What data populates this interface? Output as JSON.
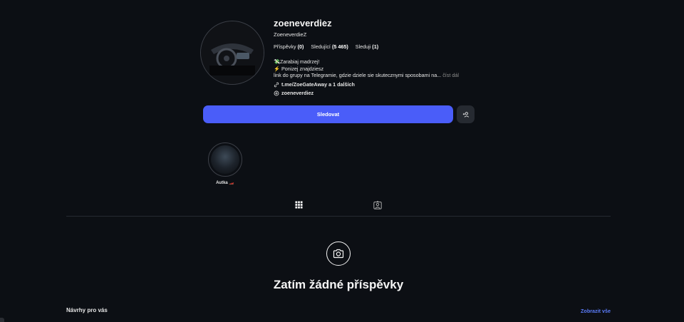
{
  "profile": {
    "username": "zoeneverdiez",
    "more_label": "···",
    "full_name": "ZoeneverdieZ",
    "stats": {
      "posts_label": "Příspěvky",
      "posts_count": "(0)",
      "followers_label": "Sledující",
      "followers_count": "(5 465)",
      "following_label": "Sleduji",
      "following_count": "(1)"
    },
    "bio": {
      "line1": "💸Zarabiaj madrzej!",
      "line2": "⚡ Ponizej znajdziesz",
      "line3": "link do grupy na Telegramie, gdzie dziele sie skutecznymi sposobami na...",
      "more": "číst dál"
    },
    "link": "t.me/ZoeGateAway a 1 dalších",
    "threads": "zoeneverdiez"
  },
  "actions": {
    "follow_label": "Sledovat",
    "suggest_icon": "person-add-icon"
  },
  "highlights": [
    {
      "label": "Autka 🏎️"
    }
  ],
  "tabs": [
    {
      "icon": "grid-icon",
      "active": true
    },
    {
      "icon": "tagged-icon",
      "active": false
    }
  ],
  "empty_state": {
    "icon": "camera-icon",
    "title": "Zatím žádné příspěvky"
  },
  "suggestions": {
    "title": "Návrhy pro vás",
    "see_all": "Zobrazit vše"
  },
  "colors": {
    "background": "#0c0f14",
    "accent": "#4a5df9",
    "link": "#5b7cf9"
  }
}
